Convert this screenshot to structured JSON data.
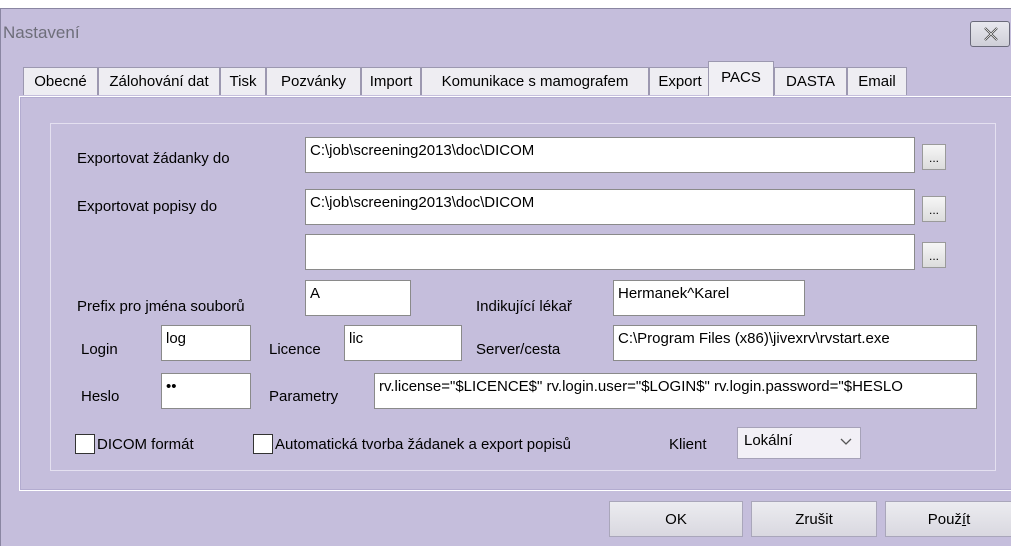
{
  "window": {
    "title": "Nastavení"
  },
  "tabs": [
    {
      "label": "Obecné"
    },
    {
      "label": "Zálohování dat"
    },
    {
      "label": "Tisk"
    },
    {
      "label": "Pozvánky"
    },
    {
      "label": "Import"
    },
    {
      "label": "Komunikace s mamografem"
    },
    {
      "label": "Export"
    },
    {
      "label": "PACS",
      "active": true
    },
    {
      "label": "DASTA"
    },
    {
      "label": "Email"
    }
  ],
  "pacs": {
    "export_requests_label": "Exportovat žádanky do",
    "export_requests_path": "C:\\job\\screening2013\\doc\\DICOM",
    "export_descriptions_label": "Exportovat popisy do",
    "export_descriptions_path": "C:\\job\\screening2013\\doc\\DICOM",
    "extra_path": "",
    "browse_label": "...",
    "prefix_label": "Prefix pro jména souborů",
    "prefix_value": "A",
    "indicating_doctor_label": "Indikující lékař",
    "indicating_doctor_value": "Hermanek^Karel",
    "login_label": "Login",
    "login_value": "log",
    "licence_label": "Licence",
    "licence_value": "lic",
    "server_label": "Server/cesta",
    "server_value": "C:\\Program Files (x86)\\jivexrv\\rvstart.exe",
    "password_label": "Heslo",
    "password_value": "••",
    "params_label": "Parametry",
    "params_value": "rv.license=\"$LICENCE$\" rv.login.user=\"$LOGIN$\" rv.login.password=\"$HESLO",
    "dicom_format_label": "DICOM formát",
    "dicom_format_checked": false,
    "auto_create_label": "Automatická tvorba žádanek a export popisů",
    "auto_create_checked": false,
    "client_label": "Klient",
    "client_value": "Lokální"
  },
  "buttons": {
    "ok": "OK",
    "cancel": "Zrušit",
    "apply_prefix": "Použ",
    "apply_underlined": "í",
    "apply_suffix": "t"
  }
}
